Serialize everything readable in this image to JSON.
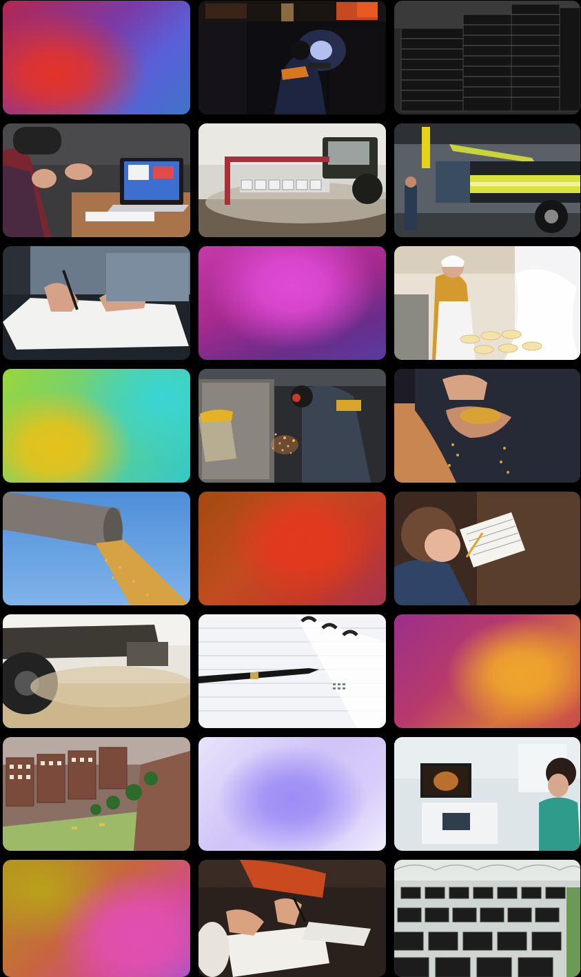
{
  "gallery": {
    "tiles": [
      {
        "kind": "gradient",
        "name": "gradient-red-violet"
      },
      {
        "kind": "photo",
        "name": "welding-worker-photo"
      },
      {
        "kind": "photo",
        "name": "stacked-black-trays-photo"
      },
      {
        "kind": "photo",
        "name": "meeting-laptop-photo"
      },
      {
        "kind": "photo",
        "name": "tractor-seeder-field-photo"
      },
      {
        "kind": "photo",
        "name": "yellow-truck-factory-photo"
      },
      {
        "kind": "photo",
        "name": "hand-writing-document-photo"
      },
      {
        "kind": "gradient",
        "name": "gradient-magenta"
      },
      {
        "kind": "photo",
        "name": "cheesemaker-woman-photo"
      },
      {
        "kind": "gradient",
        "name": "gradient-yellow-cyan"
      },
      {
        "kind": "photo",
        "name": "metal-grinding-sparks-photo"
      },
      {
        "kind": "photo",
        "name": "hands-holding-grain-photo"
      },
      {
        "kind": "photo",
        "name": "grain-spout-sky-photo"
      },
      {
        "kind": "gradient",
        "name": "gradient-orange-red"
      },
      {
        "kind": "photo",
        "name": "child-writing-notebook-photo"
      },
      {
        "kind": "photo",
        "name": "combine-harvester-photo"
      },
      {
        "kind": "photo",
        "name": "pen-on-planner-photo"
      },
      {
        "kind": "gradient",
        "name": "gradient-purple-orange"
      },
      {
        "kind": "photo",
        "name": "city-model-buildings-photo"
      },
      {
        "kind": "gradient",
        "name": "gradient-lavender"
      },
      {
        "kind": "photo",
        "name": "ultrasound-doctor-photo"
      },
      {
        "kind": "gradient",
        "name": "gradient-gold-pink"
      },
      {
        "kind": "photo",
        "name": "signing-papers-photo"
      },
      {
        "kind": "photo",
        "name": "greenhouse-black-containers-photo"
      }
    ]
  }
}
